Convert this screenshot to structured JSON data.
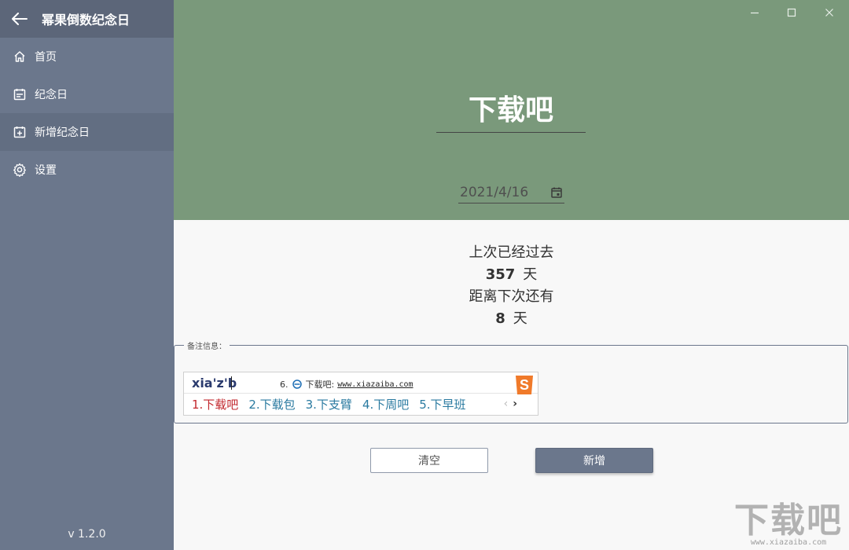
{
  "app": {
    "title": "幂果倒数纪念日",
    "version": "v 1.2.0"
  },
  "sidebar": {
    "items": [
      {
        "label": "首页",
        "icon": "home-icon"
      },
      {
        "label": "纪念日",
        "icon": "calendar-list-icon"
      },
      {
        "label": "新增纪念日",
        "icon": "calendar-add-icon",
        "active": true
      },
      {
        "label": "设置",
        "icon": "gear-icon"
      }
    ]
  },
  "event": {
    "name": "下载吧",
    "date": "2021/4/16"
  },
  "stats": {
    "since_label": "上次已经过去",
    "since_days": "357",
    "until_label": "距离下次还有",
    "until_days": "8",
    "day_unit": "天"
  },
  "note": {
    "legend": "备注信息："
  },
  "ime": {
    "input": "xia'z'b",
    "hint_index": "6.",
    "hint_text": "下载吧:",
    "hint_url": "www.xiazaiba.com",
    "candidates": [
      "1.下载吧",
      "2.下载包",
      "3.下支臂",
      "4.下周吧",
      "5.下早班"
    ]
  },
  "buttons": {
    "clear": "清空",
    "add": "新增"
  },
  "watermark": {
    "main": "下载吧",
    "sub": "www.xiazaiba.com"
  },
  "colors": {
    "sidebar": "#6b778c",
    "header_green": "#7a997b",
    "accent_red": "#c2272d",
    "candidate_blue": "#2a7aa0"
  }
}
